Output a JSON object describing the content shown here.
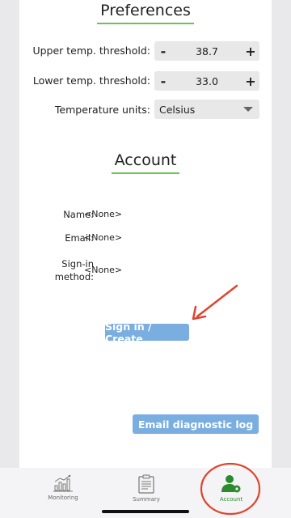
{
  "preferences": {
    "title": "Preferences",
    "upper": {
      "label": "Upper temp. threshold:",
      "minus": "-",
      "value": "38.7",
      "plus": "+"
    },
    "lower": {
      "label": "Lower temp. threshold:",
      "minus": "-",
      "value": "33.0",
      "plus": "+"
    },
    "units": {
      "label": "Temperature units:",
      "value": "Celsius"
    }
  },
  "account": {
    "title": "Account",
    "name_label": "Name:",
    "name_value": "<None>",
    "email_label": "Email:",
    "email_value": "<None>",
    "signin_label_1": "Sign-in",
    "signin_label_2": "method:",
    "signin_value": "<None>",
    "signin_button": "Sign in / Create",
    "email_log_button": "Email diagnostic log"
  },
  "nav": {
    "items": [
      {
        "label": "Monitoring",
        "icon": "chart-icon"
      },
      {
        "label": "Summary",
        "icon": "clipboard-icon"
      },
      {
        "label": "Account",
        "icon": "account-gear-icon"
      }
    ],
    "active_color": "#2b8a2b"
  },
  "colors": {
    "accent_underline": "#6fbf5a",
    "button_blue": "#7aaee0",
    "annotation_red": "#e0442f"
  }
}
